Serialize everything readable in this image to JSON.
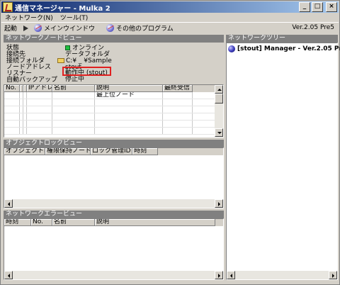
{
  "window": {
    "title": "通信マネージャー - Mulka 2",
    "buttons": {
      "minimize": "_",
      "maximize": "□",
      "close": "×"
    }
  },
  "menu": [
    {
      "label": "ネットワーク(N)"
    },
    {
      "label": "ツール(T)"
    }
  ],
  "toolbar": {
    "start_label": "起動",
    "main_window_label": "メインウインドウ",
    "other_programs_label": "その他のプログラム",
    "version": "Ver.2.05 Pre5"
  },
  "node_view": {
    "title": "ネットワークノードビュー",
    "labels": {
      "status": "状態",
      "connection": "接続先",
      "folder": "接続フォルダ",
      "address": "ノードアドレス",
      "listener": "リスナー",
      "backup": "自動バックアップ"
    },
    "values": {
      "status": "オンライン",
      "connection": "データフォルダ",
      "folder": "C:¥ _ ¥Sample",
      "address": "stout",
      "listener": "動作中 (stout)",
      "backup": "停止中"
    },
    "columns": [
      "No.",
      "",
      "",
      "IPアドレス",
      "名前",
      "説明",
      "最終受信"
    ],
    "rows": [
      {
        "description": "最上位ノード"
      }
    ]
  },
  "tree": {
    "title": "ネットワークツリー",
    "items": [
      {
        "label": "[stout] Manager - Ver.2.05 Pre.5"
      }
    ]
  },
  "lock_view": {
    "title": "オブジェクトロックビュー",
    "columns": [
      "オブジェクトID",
      "権限保持ノード",
      "ロック管理ID",
      "時刻"
    ]
  },
  "error_view": {
    "title": "ネットワークエラービュー",
    "columns": [
      "時刻",
      "No.",
      "名前",
      "説明"
    ]
  },
  "colors": {
    "titlebar_start": "#0a246a",
    "titlebar_end": "#a6caf0",
    "online": "#20c040",
    "highlight": "#e02020"
  }
}
